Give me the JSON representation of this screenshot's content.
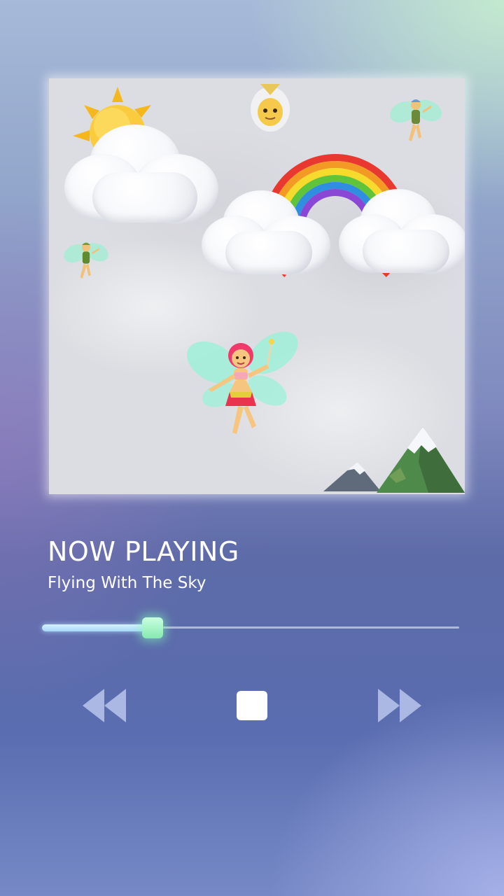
{
  "now_playing": {
    "heading": "NOW PLAYING",
    "track_title": "Flying With The Sky"
  },
  "progress": {
    "fraction": 0.265
  },
  "controls": {
    "rewind_icon": "rewind-icon",
    "stop_icon": "stop-icon",
    "forward_icon": "fast-forward-icon"
  },
  "album_art": {
    "elements": [
      "sun-emoji",
      "cloud-emoji",
      "upside-down-genie-emoji",
      "fairy-emoji",
      "rainbow-emoji",
      "snow-capped-mountain-emoji"
    ]
  },
  "colors": {
    "progress_fill": "#a7d8f8",
    "progress_thumb": "#86eab0",
    "control_icon": "#b9c6ec",
    "stop_icon": "#ffffff"
  }
}
